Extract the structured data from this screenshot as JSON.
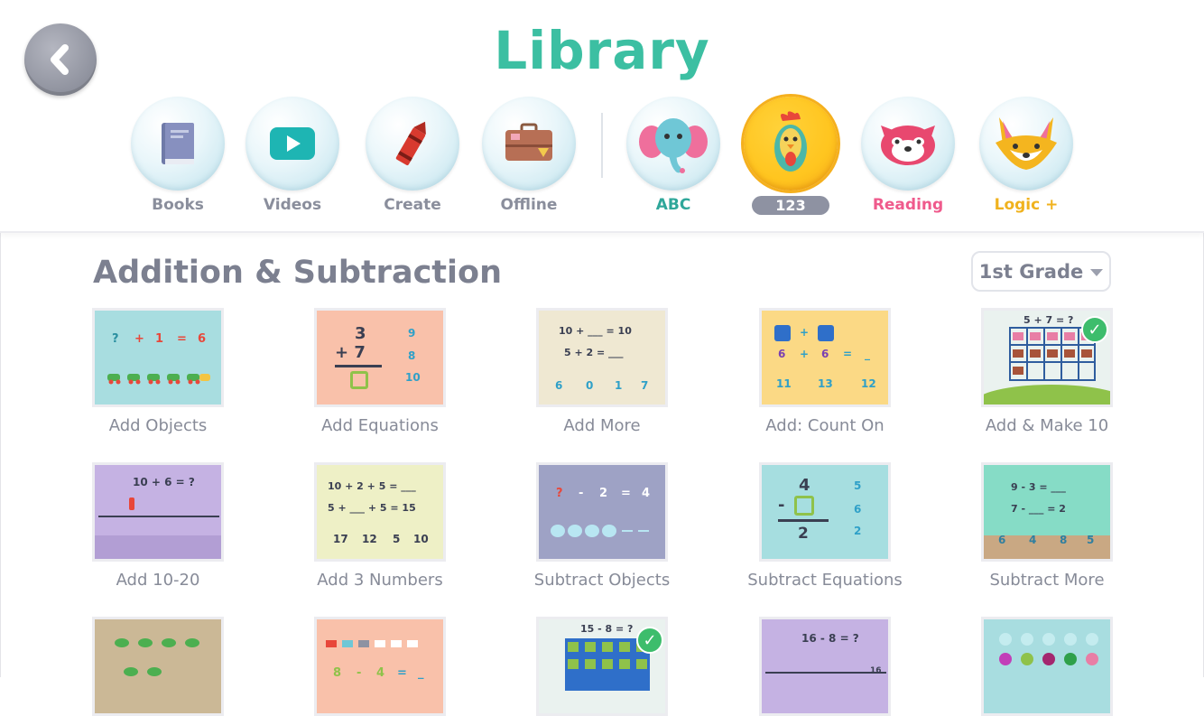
{
  "header": {
    "title": "Library",
    "back_icon": "chevron-left-icon"
  },
  "nav": {
    "items": [
      {
        "label": "Books",
        "icon": "book-icon"
      },
      {
        "label": "Videos",
        "icon": "play-icon"
      },
      {
        "label": "Create",
        "icon": "crayon-icon"
      },
      {
        "label": "Offline",
        "icon": "suitcase-icon"
      },
      {
        "label": "ABC",
        "icon": "elephant-icon"
      },
      {
        "label": "123",
        "icon": "bird-icon",
        "active": true
      },
      {
        "label": "Reading",
        "icon": "red-panda-icon"
      },
      {
        "label": "Logic +",
        "icon": "fox-icon"
      }
    ]
  },
  "section": {
    "title": "Addition & Subtraction",
    "grade": "1st Grade"
  },
  "tiles": [
    {
      "label": "Add Objects",
      "bg": "#a8dde0",
      "content": [
        "?",
        "+",
        "1",
        "=",
        "6"
      ]
    },
    {
      "label": "Add Equations",
      "bg": "#f9c1aa",
      "content": [
        "3",
        "+ 7",
        "9",
        "8",
        "10"
      ]
    },
    {
      "label": "Add More",
      "bg": "#efe8d2",
      "content": [
        "10 + ___ = 10",
        "5 + 2 = ___",
        "6",
        "0",
        "1",
        "7"
      ]
    },
    {
      "label": "Add: Count On",
      "bg": "#fbd985",
      "content": [
        "+",
        "6",
        "+",
        "6",
        "=",
        "_",
        "11",
        "13",
        "12"
      ]
    },
    {
      "label": "Add & Make 10",
      "bg": "#eaf2ef",
      "content": [
        "5 + 7 = ?"
      ]
    },
    {
      "label": "Add 10-20",
      "bg": "#c5b2e3",
      "content": [
        "10 + 6 = ?"
      ]
    },
    {
      "label": "Add 3 Numbers",
      "bg": "#eef0c6",
      "content": [
        "10 + 2 + 5 = ___",
        "5 + ___ + 5 = 15",
        "17",
        "12",
        "5",
        "10"
      ]
    },
    {
      "label": "Subtract Objects",
      "bg": "#9ea2c5",
      "content": [
        "?",
        "-",
        "2",
        "=",
        "4"
      ]
    },
    {
      "label": "Subtract Equations",
      "bg": "#a6dee0",
      "content": [
        "4",
        "-",
        "2",
        "5",
        "6",
        "2"
      ]
    },
    {
      "label": "Subtract More",
      "bg": "#86dcc6",
      "content": [
        "9 - 3 = ___",
        "7 - ___ = 2",
        "6",
        "4",
        "8",
        "5"
      ]
    },
    {
      "label": "",
      "bg": "#cbb896",
      "content": []
    },
    {
      "label": "",
      "bg": "#f9c1aa",
      "content": [
        "8",
        "-",
        "4",
        "=",
        "_"
      ]
    },
    {
      "label": "",
      "bg": "#eaf2ef",
      "content": [
        "15 - 8 = ?"
      ]
    },
    {
      "label": "",
      "bg": "#c5b2e3",
      "content": [
        "16 - 8 = ?",
        "16"
      ]
    },
    {
      "label": "",
      "bg": "#a8dde0",
      "content": []
    }
  ]
}
